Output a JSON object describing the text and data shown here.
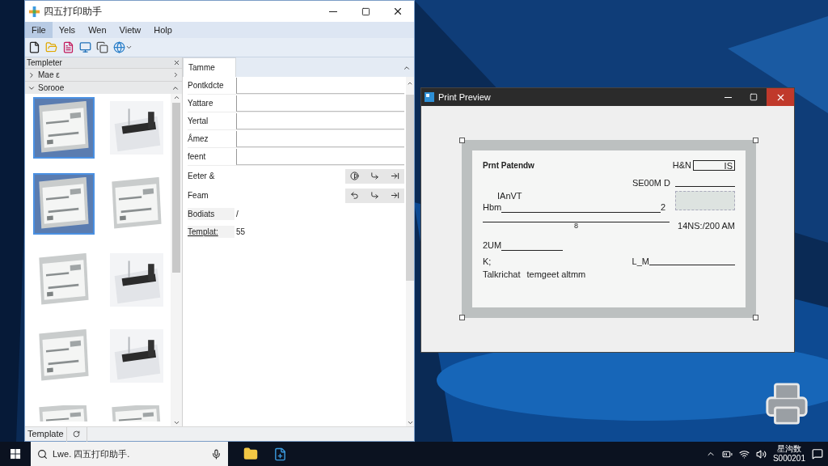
{
  "main_window": {
    "title": "四五打印助手",
    "menu": [
      {
        "label": "File",
        "selected": true
      },
      {
        "label": "Yels",
        "selected": false
      },
      {
        "label": "Wen",
        "selected": false
      },
      {
        "label": "Vietw",
        "selected": false
      },
      {
        "label": "Holp",
        "selected": false
      }
    ],
    "templates_panel": {
      "title": "Templeter",
      "sections": [
        {
          "label": "Mae ε",
          "expanded": false
        },
        {
          "label": "Sorooe",
          "expanded": true
        }
      ],
      "thumbnails": [
        {
          "kind": "check",
          "selected": true
        },
        {
          "kind": "printer",
          "selected": false
        },
        {
          "kind": "check",
          "selected": true
        },
        {
          "kind": "check",
          "selected": false
        },
        {
          "kind": "check",
          "selected": false
        },
        {
          "kind": "printer",
          "selected": false
        },
        {
          "kind": "check",
          "selected": false
        },
        {
          "kind": "printer",
          "selected": false
        },
        {
          "kind": "check",
          "selected": false
        },
        {
          "kind": "check",
          "selected": false
        }
      ]
    },
    "properties": {
      "tab": "Tamme",
      "fields": [
        {
          "label": "Pontkdcte"
        },
        {
          "label": "Yattare"
        },
        {
          "label": "Yertal"
        },
        {
          "label": "Ǻmez"
        },
        {
          "label": "feent"
        }
      ],
      "action_rows": [
        {
          "label": "Eeter &"
        },
        {
          "label": "Feam"
        }
      ],
      "values": [
        {
          "label": "Bodiats",
          "value": "/"
        },
        {
          "label": "Templat:",
          "value": "55"
        }
      ]
    },
    "status_bar": {
      "label": "Template"
    }
  },
  "print_preview": {
    "title": "Print Preview",
    "check": {
      "heading": "Prnt Patendw",
      "number_label": "H&N",
      "number": "IS",
      "date_label": "SE00M D",
      "payee_label": "IAnVT",
      "payee_prefix": "Hbm",
      "payee_mark": "2",
      "line_mark": "8",
      "time": "14NS:/200 AM",
      "amount_label": "2UM",
      "memo_label": "K;",
      "signature_label": "L_M",
      "footer_left": "Talkrichat",
      "footer_right": "temgeet altmm"
    }
  },
  "taskbar": {
    "search": "Lwe. 四五打印助手.",
    "clock": [
      "星沟数",
      "S000201"
    ]
  }
}
